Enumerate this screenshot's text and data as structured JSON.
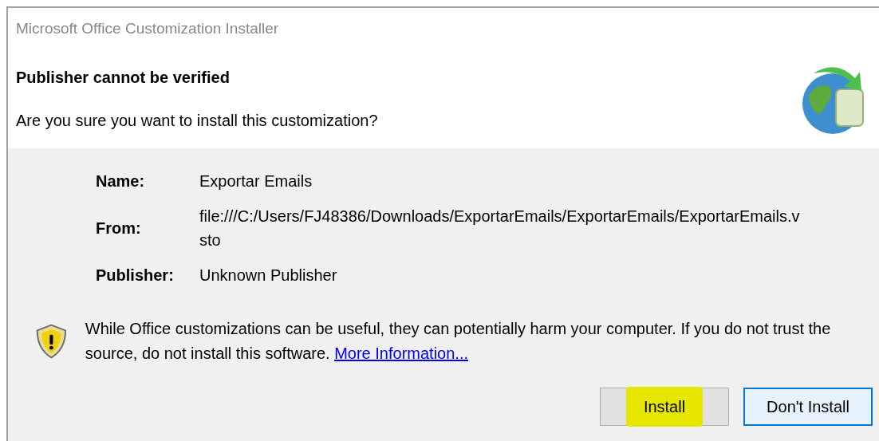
{
  "window": {
    "title": "Microsoft Office Customization Installer"
  },
  "header": {
    "heading": "Publisher cannot be verified",
    "question": "Are you sure you want to install this customization?"
  },
  "details": [
    {
      "label": "Name:",
      "value": "Exportar Emails"
    },
    {
      "label": "From:",
      "value": "file:///C:/Users/FJ48386/Downloads/ExportarEmails/ExportarEmails/ExportarEmails.vsto"
    },
    {
      "label": "Publisher:",
      "value": "Unknown Publisher"
    }
  ],
  "warning": {
    "text": "While Office customizations can be useful, they can potentially harm your computer. If you do not trust the source, do not install this software.",
    "link": "More Information..."
  },
  "buttons": [
    {
      "label": "Install",
      "highlighted": true,
      "focused": false
    },
    {
      "label": "Don't Install",
      "highlighted": false,
      "focused": true
    }
  ]
}
